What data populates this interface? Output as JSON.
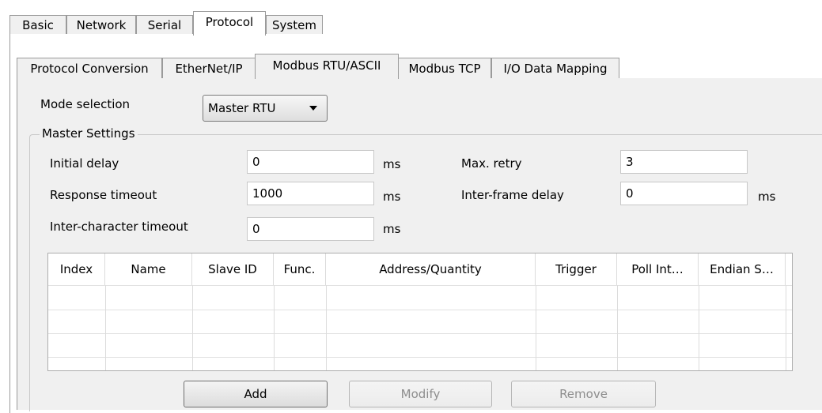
{
  "top_tabs": [
    {
      "label": "Basic"
    },
    {
      "label": "Network"
    },
    {
      "label": "Serial"
    },
    {
      "label": "Protocol"
    },
    {
      "label": "System"
    }
  ],
  "sub_tabs": [
    {
      "label": "Protocol Conversion"
    },
    {
      "label": "EtherNet/IP"
    },
    {
      "label": "Modbus RTU/ASCII"
    },
    {
      "label": "Modbus TCP"
    },
    {
      "label": "I/O Data Mapping"
    }
  ],
  "mode": {
    "label": "Mode selection",
    "value": "Master RTU"
  },
  "master": {
    "title": "Master Settings",
    "initial_delay": {
      "label": "Initial delay",
      "value": "0",
      "unit": "ms"
    },
    "response_timeout": {
      "label": "Response timeout",
      "value": "1000",
      "unit": "ms"
    },
    "inter_char_timeout": {
      "label": "Inter-character timeout",
      "value": "0",
      "unit": "ms"
    },
    "max_retry": {
      "label": "Max. retry",
      "value": "3"
    },
    "inter_frame_delay": {
      "label": "Inter-frame delay",
      "value": "0",
      "unit": "ms"
    }
  },
  "table": {
    "columns": [
      "Index",
      "Name",
      "Slave ID",
      "Func.",
      "Address/Quantity",
      "Trigger",
      "Poll Int…",
      "Endian S…"
    ]
  },
  "buttons": {
    "add": "Add",
    "modify": "Modify",
    "remove": "Remove"
  }
}
